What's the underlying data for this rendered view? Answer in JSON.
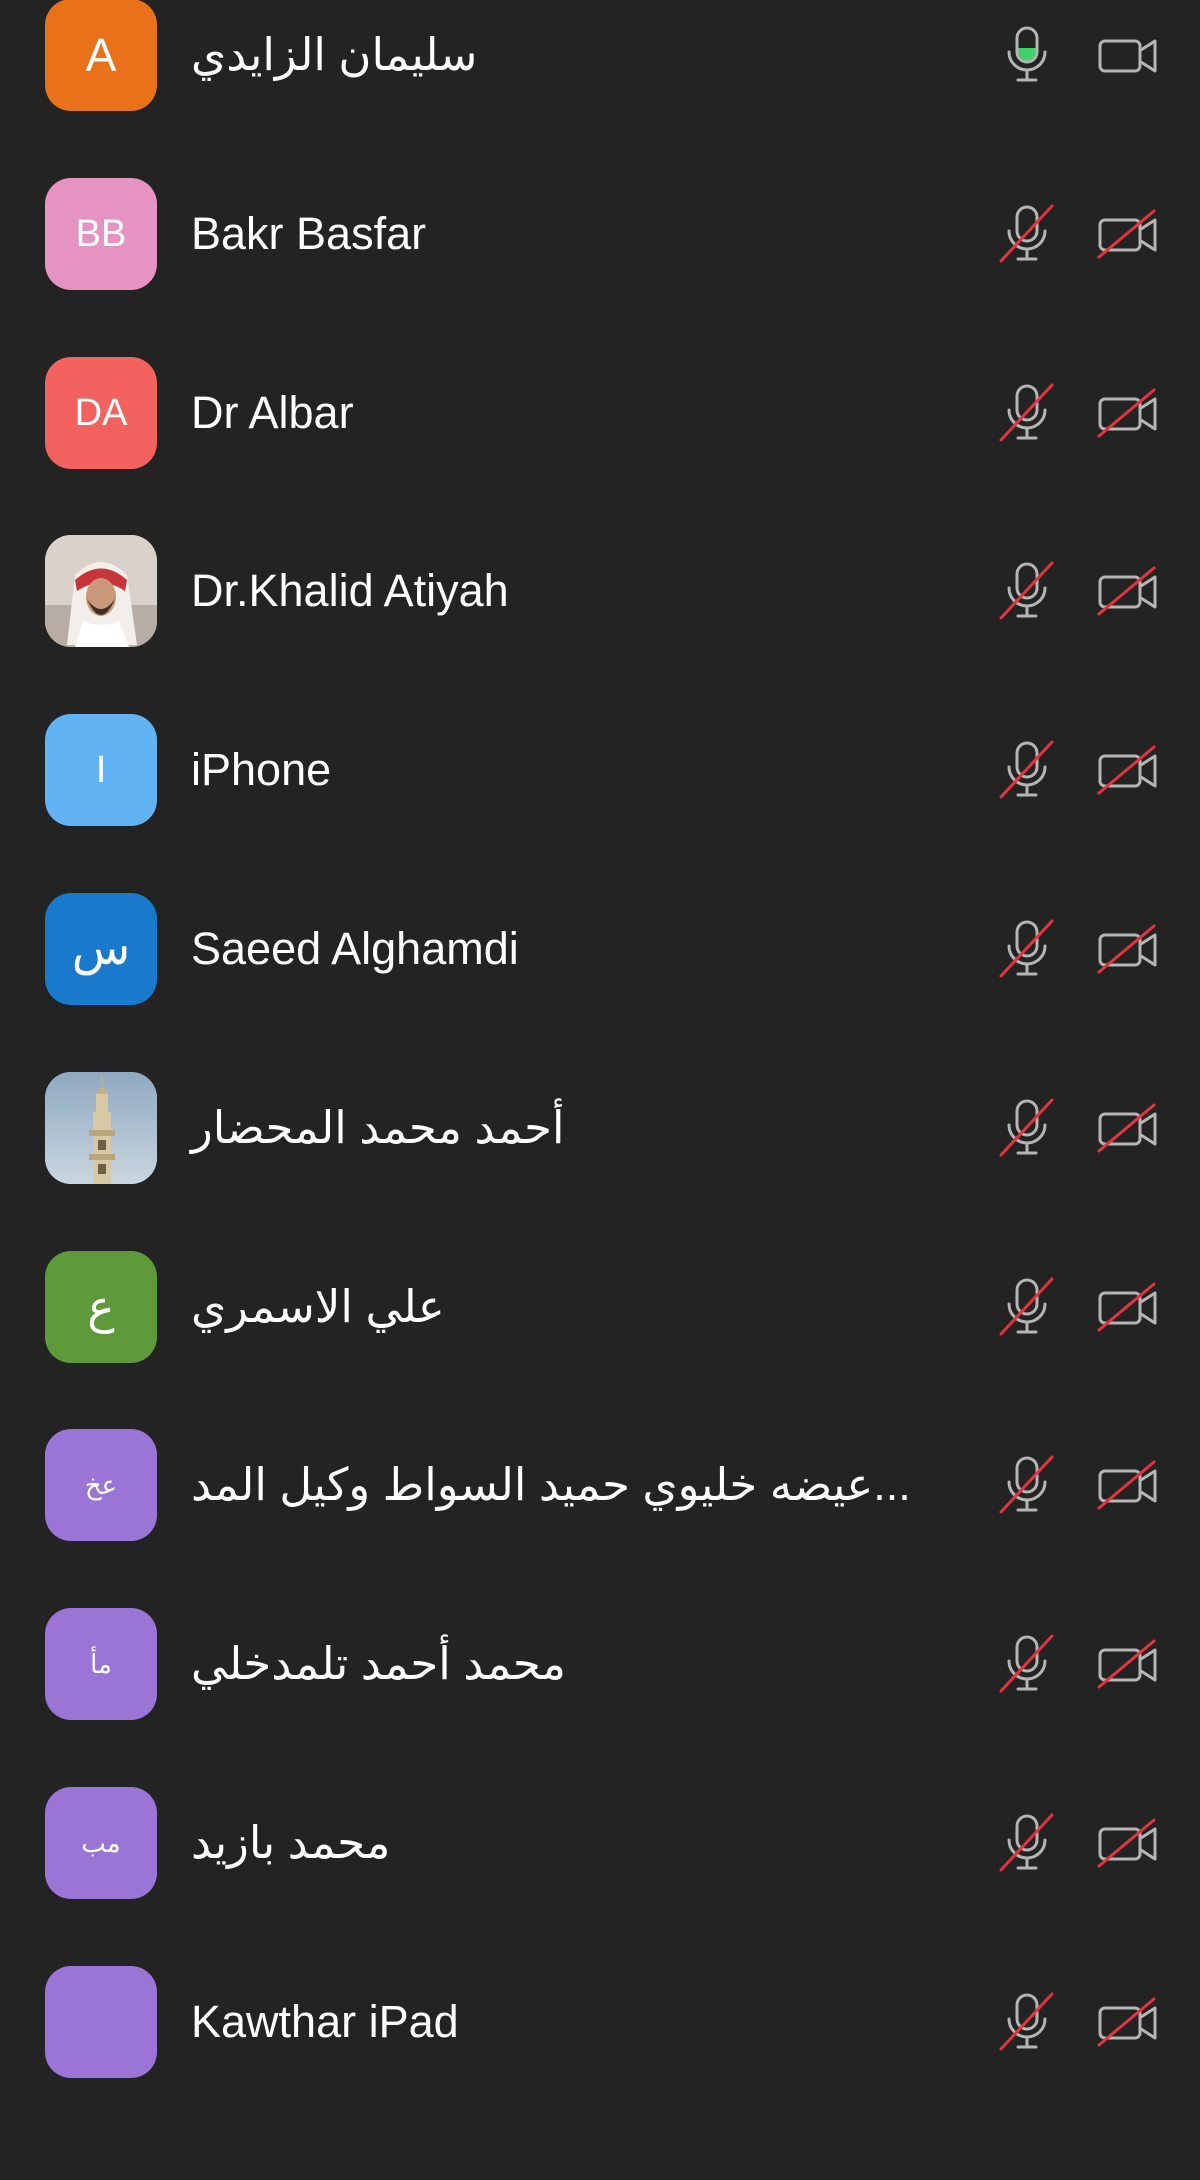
{
  "participants": [
    {
      "name": "سليمان الزايدي",
      "initials": "A",
      "avatar_color": "#E8711A",
      "avatar_type": "initials",
      "initials_size": 46,
      "muted": false,
      "video_off": false
    },
    {
      "name": "Bakr Basfar",
      "initials": "BB",
      "avatar_color": "#E493C2",
      "avatar_type": "initials",
      "initials_size": 38,
      "muted": true,
      "video_off": true
    },
    {
      "name": "Dr Albar",
      "initials": "DA",
      "avatar_color": "#F2625E",
      "avatar_type": "initials",
      "initials_size": 38,
      "muted": true,
      "video_off": true
    },
    {
      "name": "Dr.Khalid Atiyah",
      "initials": "",
      "avatar_color": "#C9C3BC",
      "avatar_type": "photo-person",
      "initials_size": 38,
      "muted": true,
      "video_off": true
    },
    {
      "name": "iPhone",
      "initials": "I",
      "avatar_color": "#62B3F3",
      "avatar_type": "initials",
      "initials_size": 38,
      "muted": true,
      "video_off": true
    },
    {
      "name": "Saeed Alghamdi",
      "initials": "س",
      "avatar_color": "#1979CC",
      "avatar_type": "initials",
      "initials_size": 48,
      "muted": true,
      "video_off": true
    },
    {
      "name": "أحمد محمد المحضار",
      "initials": "",
      "avatar_color": "#9FB6C8",
      "avatar_type": "photo-minaret",
      "initials_size": 38,
      "muted": true,
      "video_off": true
    },
    {
      "name": "علي الاسمري",
      "initials": "ع",
      "avatar_color": "#5E9A39",
      "avatar_type": "initials",
      "initials_size": 46,
      "muted": true,
      "video_off": true
    },
    {
      "name": "عيضه خليوي حميد السواط وكيل المد...",
      "initials": "عخ",
      "avatar_color": "#9A75D6",
      "avatar_type": "initials",
      "initials_size": 26,
      "muted": true,
      "video_off": true
    },
    {
      "name": "محمد أحمد تلمدخلي",
      "initials": "مأ",
      "avatar_color": "#9A75D6",
      "avatar_type": "initials",
      "initials_size": 26,
      "muted": true,
      "video_off": true
    },
    {
      "name": "محمد بازيد",
      "initials": "مب",
      "avatar_color": "#9A75D6",
      "avatar_type": "initials",
      "initials_size": 26,
      "muted": true,
      "video_off": true
    },
    {
      "name": "Kawthar iPad",
      "initials": "",
      "avatar_color": "#9A75D6",
      "avatar_type": "initials",
      "initials_size": 38,
      "muted": true,
      "video_off": true
    }
  ],
  "icons": {
    "mic": "microphone-icon",
    "mic_muted": "microphone-muted-icon",
    "camera": "video-camera-icon",
    "camera_off": "video-camera-off-icon"
  },
  "colors": {
    "background": "#232323",
    "icon_stroke": "#B5B5B5",
    "mute_slash": "#E0353F",
    "mic_active": "#3FD36A"
  }
}
